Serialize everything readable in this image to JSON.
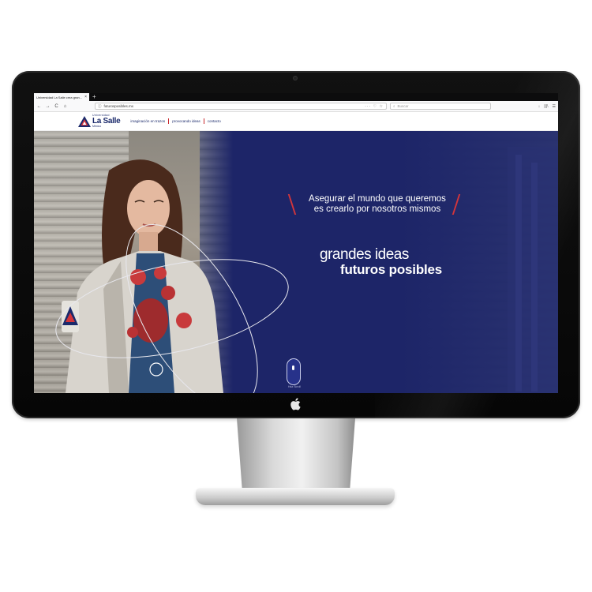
{
  "browser": {
    "tab_title": "Universidad La Salle crea gran...",
    "tab_close": "×",
    "new_tab": "+",
    "nav": {
      "back": "←",
      "forward": "→",
      "reload": "C",
      "home": "⌂"
    },
    "url": "futurosposibles.mx",
    "url_actions": "··· ♡ ☆",
    "search_placeholder": "Buscar",
    "right_icons": [
      "↓",
      "|||\\",
      "☰"
    ]
  },
  "site": {
    "logo": {
      "small": "Universidad",
      "main": "La Salle",
      "sub": "México"
    },
    "nav_items": [
      "imaginación en trazos",
      "provocando ideas",
      "contacto"
    ]
  },
  "hero": {
    "quote_line1": "Asegurar el mundo que queremos",
    "quote_line2": "es crearlo por nosotros mismos",
    "tagline1": "grandes ideas",
    "tagline2": "futuros posibles",
    "scroll_label": "Haz Scroll"
  },
  "colors": {
    "hero_blue": "#1b2467",
    "accent_red": "#d3353b",
    "brand_navy": "#1b2a6b"
  },
  "icons": [
    "apple-logo-icon",
    "search-icon",
    "download-icon",
    "library-icon",
    "menu-icon",
    "home-icon",
    "reload-icon"
  ]
}
